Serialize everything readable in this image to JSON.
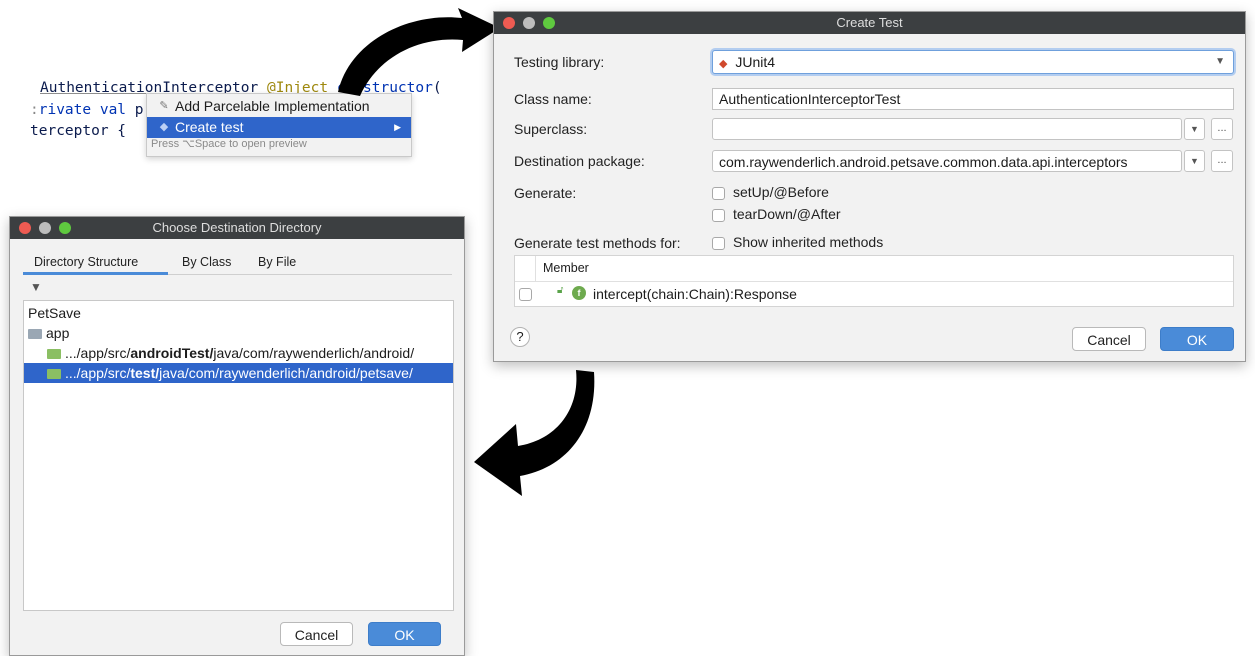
{
  "code": {
    "line1": {
      "class_name": "AuthenticationInterceptor",
      "annotation": "@Inject",
      "keyword": "constructor",
      "tail": "("
    },
    "line2": {
      "keyword": "rivate val",
      "prefix": ":",
      "name": "pre"
    },
    "line3": {
      "text": "terceptor {"
    }
  },
  "context_menu": {
    "items": [
      {
        "label": "Add Parcelable Implementation",
        "icon": "wand-icon"
      },
      {
        "label": "Create test",
        "icon": "test-icon",
        "submenu_arrow": "▶"
      }
    ],
    "hint": "Press ⌥Space to open preview"
  },
  "create_test": {
    "title": "Create Test",
    "testing_library": {
      "label": "Testing library:",
      "value": "JUnit4"
    },
    "class_name": {
      "label": "Class name:",
      "value": "AuthenticationInterceptorTest"
    },
    "superclass": {
      "label": "Superclass:",
      "value": ""
    },
    "destination_package": {
      "label": "Destination package:",
      "value": "com.raywenderlich.android.petsave.common.data.api.interceptors"
    },
    "generate": {
      "label": "Generate:",
      "options": [
        "setUp/@Before",
        "tearDown/@After"
      ]
    },
    "test_methods": {
      "label": "Generate test methods for:",
      "show_inherited": "Show inherited methods"
    },
    "table": {
      "header": "Member",
      "rows": [
        "intercept(chain:Chain):Response"
      ]
    },
    "ellipsis": "...",
    "help": "?",
    "cancel": "Cancel",
    "ok": "OK"
  },
  "choose_dir": {
    "title": "Choose Destination Directory",
    "tabs": [
      "Directory Structure",
      "By Class",
      "By File"
    ],
    "tree": {
      "root": "PetSave",
      "module": "app",
      "paths": [
        {
          "prefix": ".../app/src/",
          "bold": "androidTest/",
          "suffix": "java/com/raywenderlich/android/"
        },
        {
          "prefix": ".../app/src/",
          "bold": "test/",
          "suffix": "java/com/raywenderlich/android/petsave/"
        }
      ]
    },
    "cancel": "Cancel",
    "ok": "OK"
  },
  "colors": {
    "selection": "#2f65ca",
    "primary_button": "#4a8bd8",
    "titlebar": "#3c3f41",
    "folder_green": "#8bbf63",
    "folder_gray": "#9aa7b4"
  }
}
